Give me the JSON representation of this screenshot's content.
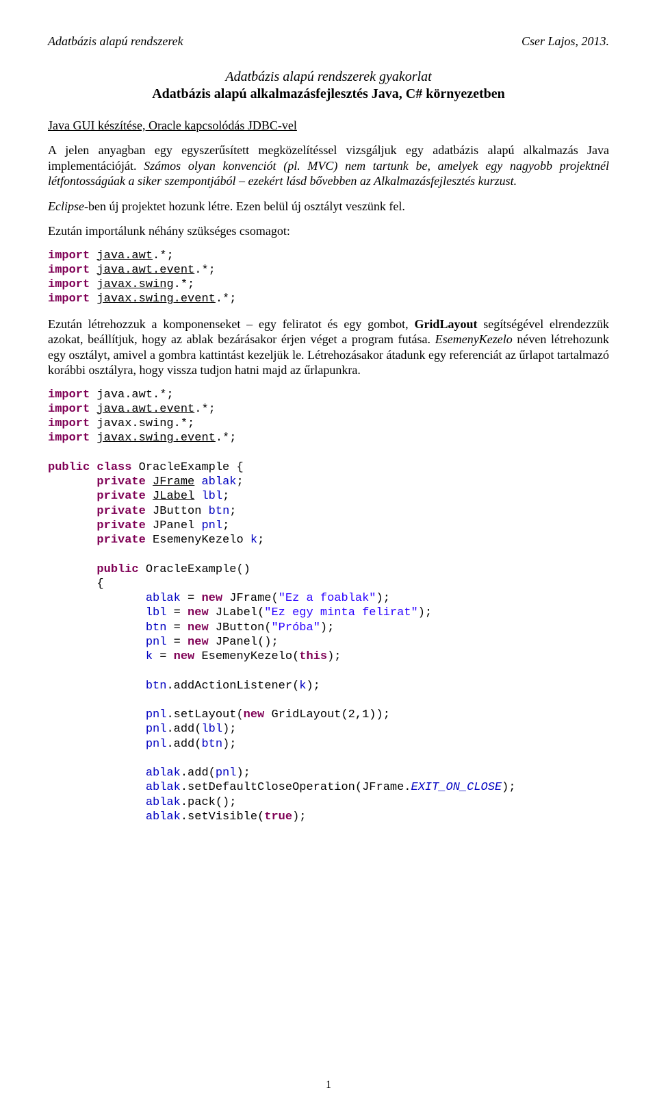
{
  "header": {
    "left": "Adatbázis alapú rendszerek",
    "right": "Cser Lajos, 2013."
  },
  "subtitle": "Adatbázis alapú rendszerek gyakorlat",
  "maintitle": "Adatbázis alapú alkalmazásfejlesztés Java, C# környezetben",
  "section": "Java GUI készítése, Oracle kapcsolódás JDBC-vel",
  "para1_pre": "A jelen anyagban egy egyszerűsített megközelítéssel vizsgáljuk egy adatbázis alapú alkalmazás Java implementációját. ",
  "para1_mid": "Számos olyan konvenciót (pl. MVC) nem tartunk be, amelyek egy nagyobb projektnél létfontosságúak a siker szempontjából – ezekért lásd bővebben az Alkalmazásfejlesztés kurzust.",
  "para2_pre": "Eclipse",
  "para2_post": "-ben új projektet hozunk létre. Ezen belül új osztályt veszünk fel.",
  "para3": "Ezután importálunk néhány szükséges csomagot:",
  "imports": {
    "l1a": "import",
    "l1b": "java.awt",
    "l1c": ".*;",
    "l2a": "import",
    "l2b": "java.awt.event",
    "l2c": ".*;",
    "l3a": "import",
    "l3b": "javax.swing",
    "l3c": ".*;",
    "l4a": "import",
    "l4b": "javax.swing.event",
    "l4c": ".*;"
  },
  "para4_a": "Ezután létrehozzuk a komponenseket – egy feliratot és egy gombot, ",
  "para4_b": "GridLayout",
  "para4_c": " segítségével elrendezzük azokat, beállítjuk, hogy az ablak bezárásakor érjen véget a program futása. ",
  "para4_d": "EsemenyKezelo",
  "para4_e": " néven létrehozunk egy osztályt, amivel a gombra kattintást kezeljük le. Létrehozásakor átadunk egy referenciát az űrlapot tartalmazó korábbi osztályra, hogy vissza tudjon hatni majd az űrlapunkra.",
  "code2": {
    "i1": "import",
    "i1p": " java.awt.*;",
    "i2": "import",
    "i2t": "java.awt.event",
    "i2e": ".*;",
    "i3": "import",
    "i3p": " javax.swing.*;",
    "i4": "import",
    "i4t": "javax.swing.event",
    "i4e": ".*;",
    "pc": "public class",
    "cname": " OracleExample {",
    "pv": "private",
    "jframe": "JFrame",
    "ablak": "ablak",
    "jlabel": "JLabel",
    "lbl": "lbl",
    "jbutton": " JButton ",
    "btn": "btn",
    "jpanel": " JPanel ",
    "pnl": "pnl",
    "ek": " EsemenyKezelo ",
    "k": "k",
    "pub": "public",
    "ctor": " OracleExample()",
    "new": "new",
    "s_jframe": "\"Ez a foablak\"",
    "s_jlabel": "\"Ez egy minta felirat\"",
    "s_jbutton": "\"Próba\"",
    "this": "this",
    "exit": "EXIT_ON_CLOSE",
    "true": "true",
    "eq": " = ",
    "semi": ";",
    "jframe2": " JFrame(",
    "jlabel2": " JLabel(",
    "jbutton2": " JButton(",
    "jpanel2": " JPanel();",
    "ek2": " EsemenyKezelo(",
    "close": ");",
    "addL": ".addActionListener(",
    "setL": ".setLayout(",
    "grid": " GridLayout(2,1));",
    "add": ".add(",
    "setD": ".setDefaultCloseOperation(JFrame.",
    "pack": ".pack();",
    "setV": ".setVisible("
  },
  "pageno": "1"
}
